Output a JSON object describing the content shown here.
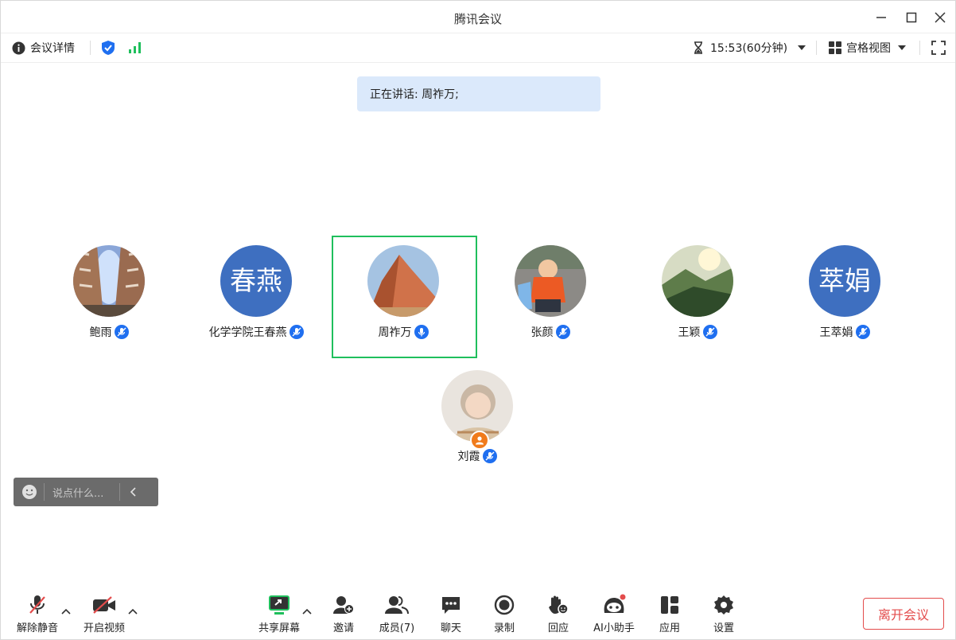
{
  "window": {
    "title": "腾讯会议"
  },
  "infobar": {
    "details_label": "会议详情",
    "timer": "15:53(60分钟)",
    "view_label": "宫格视图"
  },
  "speaking": {
    "text": "正在讲话: 周祚万;"
  },
  "participants": [
    {
      "name": "鲍雨",
      "avatar": "photo"
    },
    {
      "name": "化学学院王春燕",
      "avatar": "text",
      "avatar_text": "春燕"
    },
    {
      "name": "周祚万",
      "avatar": "photo",
      "active": true
    },
    {
      "name": "张颜",
      "avatar": "photo"
    },
    {
      "name": "王颖",
      "avatar": "photo"
    },
    {
      "name": "王萃娟",
      "avatar": "text",
      "avatar_text": "萃娟"
    },
    {
      "name": "刘霞",
      "avatar": "photo",
      "host": true
    }
  ],
  "chat": {
    "placeholder": "说点什么..."
  },
  "toolbar": {
    "unmute": "解除静音",
    "video": "开启视频",
    "share": "共享屏幕",
    "invite": "邀请",
    "members": "成员(7)",
    "chat": "聊天",
    "record": "录制",
    "react": "回应",
    "ai": "AI小助手",
    "apps": "应用",
    "settings": "设置",
    "leave": "离开会议"
  },
  "colors": {
    "accent": "#1f6ff0",
    "active_border": "#1fbf5c",
    "leave": "#e34c4c",
    "avatar_bg": "#3e6fc0"
  }
}
